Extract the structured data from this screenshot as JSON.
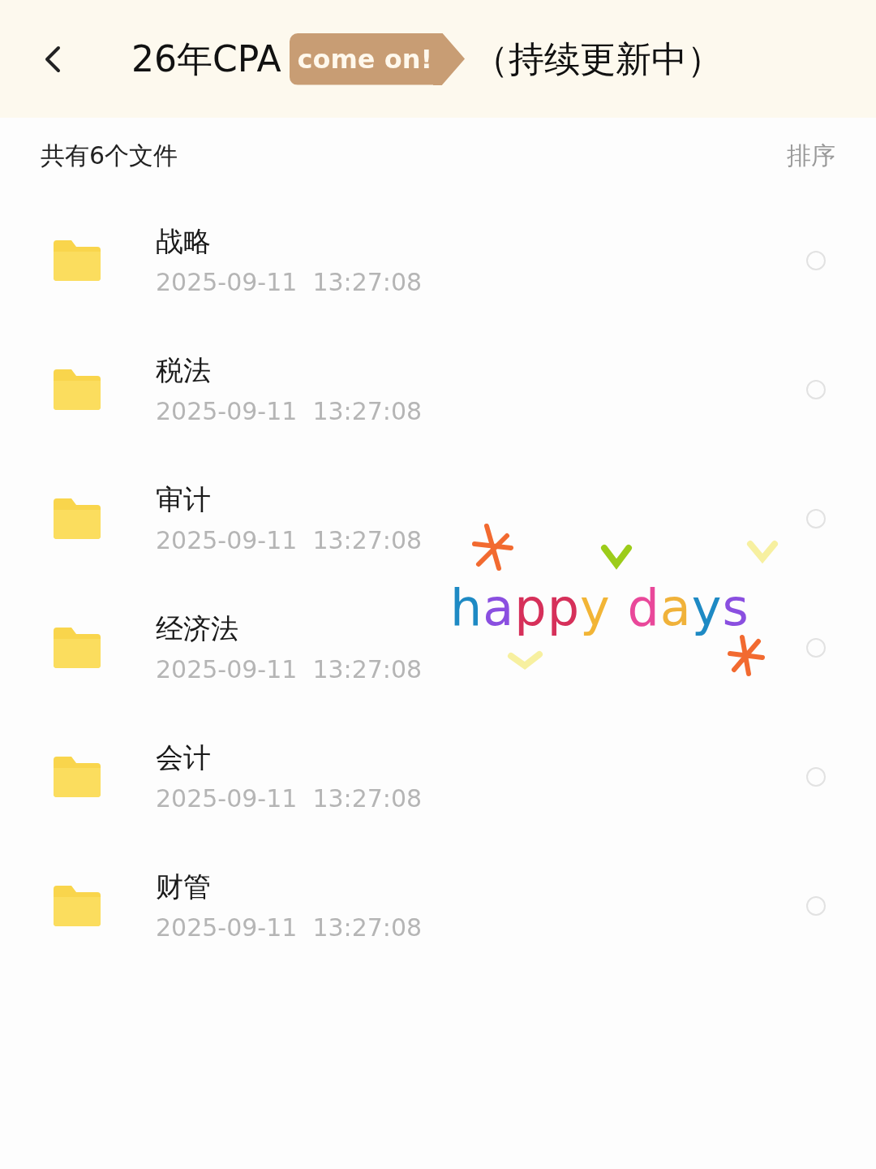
{
  "header": {
    "title_start": "26年CPA",
    "sticker": "come on!",
    "title_end": "（持续更新中）"
  },
  "summary": "共有6个文件",
  "sort": "排序",
  "files": [
    {
      "name": "战略",
      "date": "2025-09-11",
      "time": "13:27:08",
      "selected": false
    },
    {
      "name": "税法",
      "date": "2025-09-11",
      "time": "13:27:08",
      "selected": false
    },
    {
      "name": "审计",
      "date": "2025-09-11",
      "time": "13:27:08",
      "selected": false
    },
    {
      "name": "经济法",
      "date": "2025-09-11",
      "time": "13:27:08",
      "selected": false
    },
    {
      "name": "会计",
      "date": "2025-09-11",
      "time": "13:27:08",
      "selected": false
    },
    {
      "name": "财管",
      "date": "2025-09-11",
      "time": "13:27:08",
      "selected": false
    }
  ],
  "overlay": {
    "text": "happy days"
  }
}
